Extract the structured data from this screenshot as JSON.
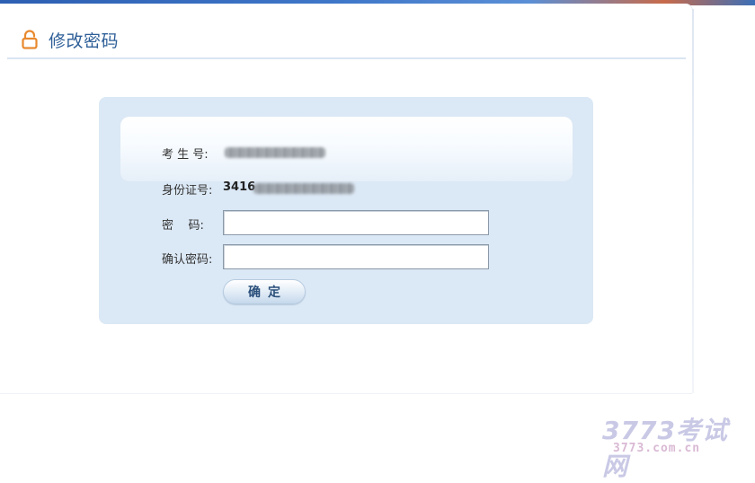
{
  "page": {
    "title": "修改密码",
    "icon": "lock-icon",
    "accent_color": "#e8892e",
    "title_color": "#2e5f98"
  },
  "form": {
    "fields": [
      {
        "label": "考 生 号:",
        "value_visible": "",
        "obscured": true
      },
      {
        "label": "身份证号:",
        "value_visible": "3416",
        "obscured": true
      },
      {
        "label": "密    码:",
        "value": "",
        "type": "password"
      },
      {
        "label": "确认密码:",
        "value": "",
        "type": "password"
      }
    ],
    "submit_label": "确定"
  },
  "watermark": {
    "main": "3773考试网",
    "sub": "3773.com.cn"
  }
}
